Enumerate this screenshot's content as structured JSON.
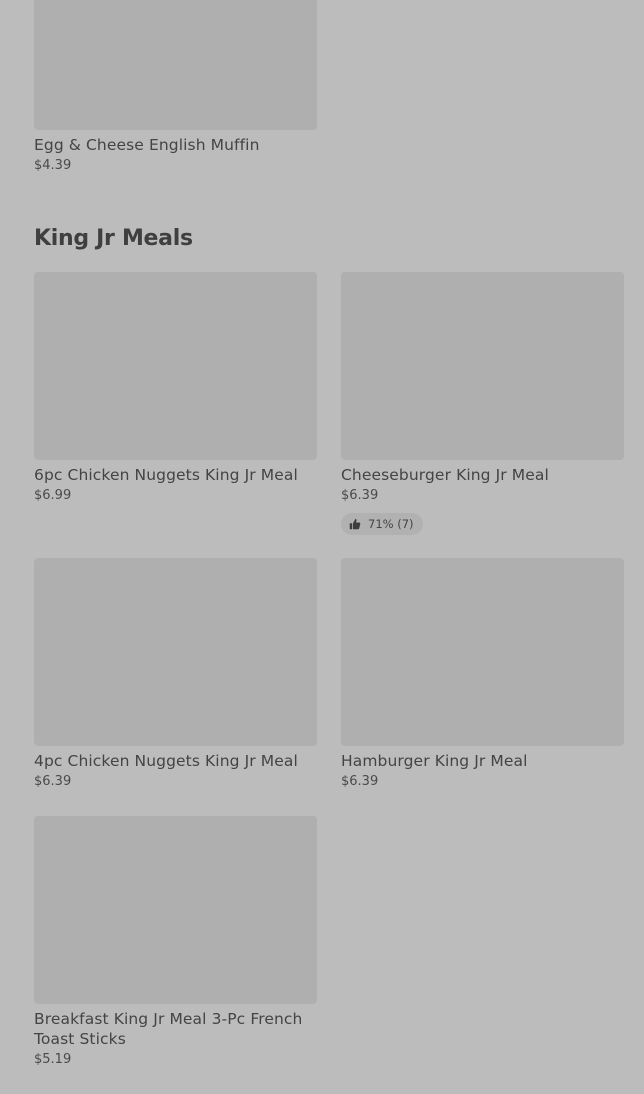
{
  "previous_item": {
    "name": "Egg & Cheese English Muffin",
    "price": "$4.39"
  },
  "section": {
    "title": "King Jr Meals",
    "items": [
      {
        "name": "6pc Chicken Nuggets King Jr Meal",
        "price": "$6.99"
      },
      {
        "name": "Cheeseburger King Jr Meal",
        "price": "$6.39",
        "rating": "71% (7)",
        "rating_icon": "thumbs-up-icon"
      },
      {
        "name": "4pc Chicken Nuggets King Jr Meal",
        "price": "$6.39"
      },
      {
        "name": "Hamburger King Jr Meal",
        "price": "$6.39"
      },
      {
        "name": "Breakfast King Jr Meal 3-Pc French Toast Sticks",
        "price": "$5.19"
      }
    ]
  },
  "colors": {
    "background": "#bcbcbc",
    "image_placeholder": "#afafaf",
    "text": "#444444"
  }
}
